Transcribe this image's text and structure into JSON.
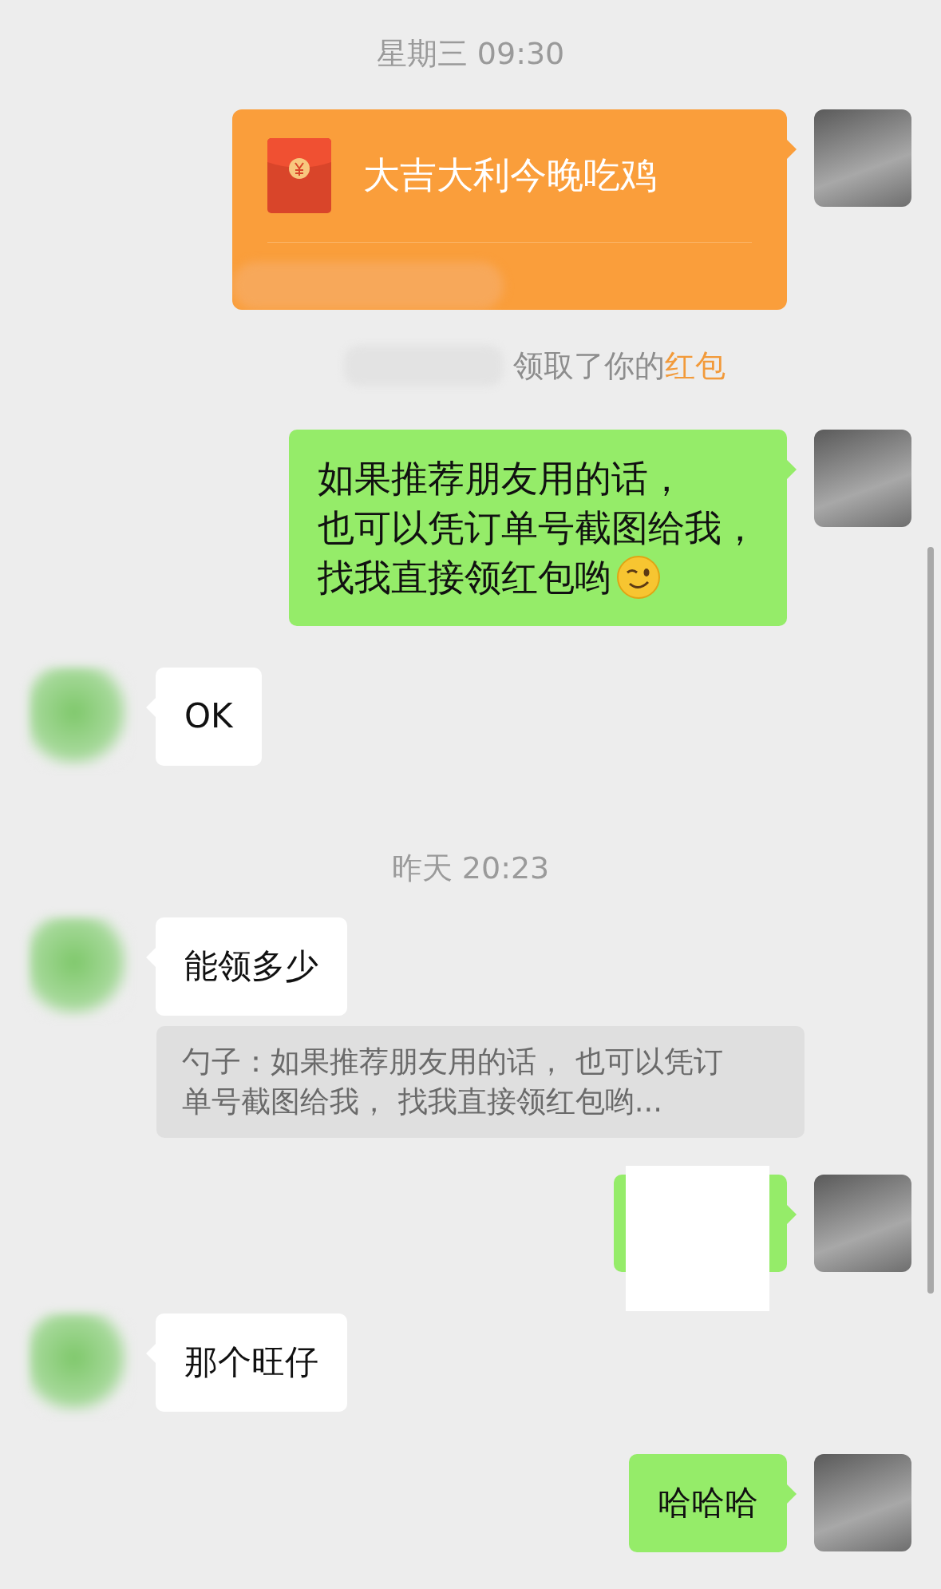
{
  "messages": [
    {
      "kind": "time",
      "text": "星期三 09:30"
    },
    {
      "kind": "redpacket",
      "outgoing": true,
      "text": "大吉大利今晚吃鸡"
    },
    {
      "kind": "system",
      "text": "领取了你的",
      "highlight": "红包"
    },
    {
      "kind": "text",
      "outgoing": true,
      "lines": [
        "如果推荐朋友用的话，",
        "也可以凭订单号截图给我，",
        "找我直接领红包哟"
      ]
    },
    {
      "kind": "text",
      "outgoing": false,
      "lines": [
        "OK"
      ]
    },
    {
      "kind": "time",
      "text": "昨天 20:23"
    },
    {
      "kind": "text",
      "outgoing": false,
      "lines": [
        "能领多少"
      ]
    },
    {
      "kind": "quote",
      "text": "勺子：如果推荐朋友用的话， 也可以凭订单号截图给我， 找我直接领红包哟..."
    },
    {
      "kind": "sticker",
      "outgoing": true
    },
    {
      "kind": "text",
      "outgoing": false,
      "lines": [
        "那个旺仔"
      ]
    },
    {
      "kind": "text",
      "outgoing": true,
      "lines": [
        "哈哈哈"
      ]
    }
  ]
}
